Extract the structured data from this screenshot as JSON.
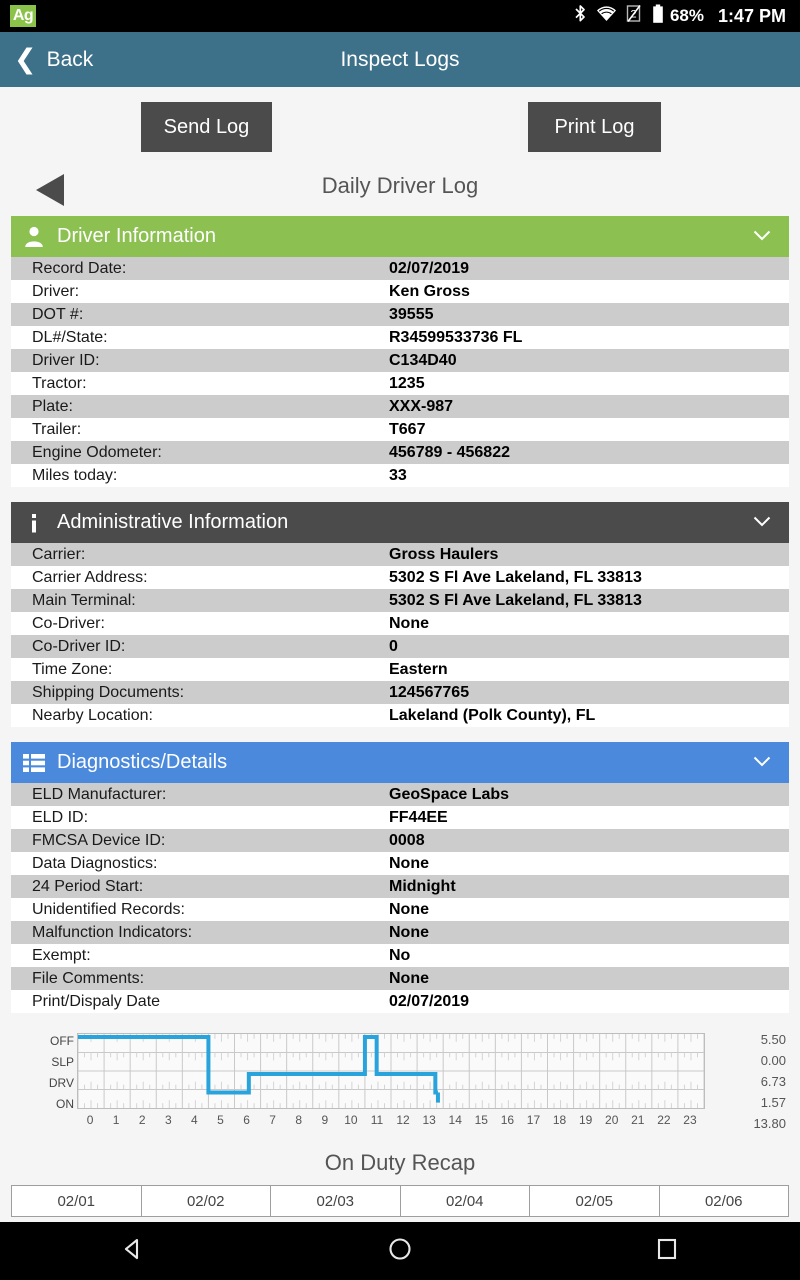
{
  "status_bar": {
    "app_badge": "Ag",
    "icons": [
      "bluetooth-icon",
      "wifi-icon",
      "sim-signal-icon",
      "battery-icon"
    ],
    "battery_percent": "68%",
    "time": "1:47 PM"
  },
  "app_bar": {
    "back_label": "Back",
    "title": "Inspect Logs"
  },
  "toolbar": {
    "send_log_label": "Send Log",
    "print_log_label": "Print Log"
  },
  "log_title": "Daily Driver Log",
  "sections": [
    {
      "id": "driver-information",
      "title": "Driver Information",
      "icon": "person-icon",
      "color": "#8cc152",
      "rows": [
        {
          "key": "Record Date:",
          "value": "02/07/2019"
        },
        {
          "key": "Driver:",
          "value": "Ken Gross"
        },
        {
          "key": "DOT #:",
          "value": "39555"
        },
        {
          "key": "DL#/State:",
          "value": "R34599533736 FL"
        },
        {
          "key": "Driver ID:",
          "value": "C134D40"
        },
        {
          "key": "Tractor:",
          "value": "1235"
        },
        {
          "key": "Plate:",
          "value": "XXX-987"
        },
        {
          "key": "Trailer:",
          "value": "T667"
        },
        {
          "key": "Engine Odometer:",
          "value": "456789 - 456822"
        },
        {
          "key": "Miles today:",
          "value": "33"
        }
      ]
    },
    {
      "id": "administrative-information",
      "title": "Administrative Information",
      "icon": "info-icon",
      "color": "#4b4b4b",
      "rows": [
        {
          "key": "Carrier:",
          "value": "Gross Haulers"
        },
        {
          "key": "Carrier Address:",
          "value": "5302 S Fl Ave Lakeland, FL 33813"
        },
        {
          "key": "Main Terminal:",
          "value": "5302 S Fl Ave Lakeland, FL 33813"
        },
        {
          "key": "Co-Driver:",
          "value": "None"
        },
        {
          "key": "Co-Driver ID:",
          "value": "0"
        },
        {
          "key": "Time Zone:",
          "value": "Eastern"
        },
        {
          "key": "Shipping Documents:",
          "value": "124567765"
        },
        {
          "key": "Nearby Location:",
          "value": "Lakeland (Polk County), FL"
        }
      ]
    },
    {
      "id": "diagnostics-details",
      "title": "Diagnostics/Details",
      "icon": "list-icon",
      "color": "#4a89dc",
      "rows": [
        {
          "key": "ELD Manufacturer:",
          "value": "GeoSpace Labs"
        },
        {
          "key": "ELD ID:",
          "value": "FF44EE"
        },
        {
          "key": "FMCSA Device ID:",
          "value": "0008"
        },
        {
          "key": "Data Diagnostics:",
          "value": "None"
        },
        {
          "key": "24 Period Start:",
          "value": "Midnight"
        },
        {
          "key": "Unidentified Records:",
          "value": "None"
        },
        {
          "key": "Malfunction Indicators:",
          "value": "None"
        },
        {
          "key": "Exempt:",
          "value": "No"
        },
        {
          "key": "File Comments:",
          "value": "None"
        },
        {
          "key": "Print/Dispaly Date",
          "value": "02/07/2019"
        }
      ]
    }
  ],
  "chart_data": {
    "type": "line",
    "title": "Daily Driver Log Duty Status Graph",
    "xlabel": "",
    "ylabel": "",
    "grid": true,
    "line_color": "#29a3dc",
    "x": [
      0,
      1,
      2,
      3,
      4,
      5,
      6,
      7,
      8,
      9,
      10,
      11,
      12,
      13,
      14,
      15,
      16,
      17,
      18,
      19,
      20,
      21,
      22,
      23
    ],
    "xlim": [
      0,
      24
    ],
    "statuses": [
      "OFF",
      "SLP",
      "DRV",
      "ON"
    ],
    "totals": [
      "5.50",
      "0.00",
      "6.73",
      "1.57"
    ],
    "grand_total": "13.80",
    "segments": [
      {
        "status": "OFF",
        "start": 0.0,
        "end": 5.0
      },
      {
        "status": "ON",
        "start": 5.0,
        "end": 6.55
      },
      {
        "status": "DRV",
        "start": 6.55,
        "end": 11.0
      },
      {
        "status": "OFF",
        "start": 11.0,
        "end": 11.45
      },
      {
        "status": "DRV",
        "start": 11.45,
        "end": 13.7
      },
      {
        "status": "ON",
        "start": 13.7,
        "end": 13.8
      }
    ]
  },
  "recap": {
    "title": "On Duty Recap",
    "columns": [
      "02/01",
      "02/02",
      "02/03",
      "02/04",
      "02/05",
      "02/06"
    ]
  },
  "nav_bar": {
    "back": "nav-back-icon",
    "home": "nav-home-icon",
    "recents": "nav-recents-icon"
  }
}
